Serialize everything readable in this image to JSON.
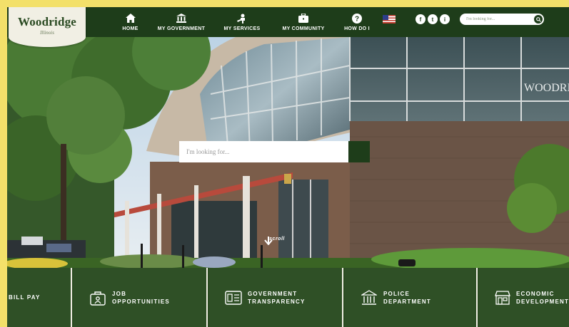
{
  "logo": {
    "name": "Woodridge",
    "sub": "Illinois"
  },
  "nav": [
    {
      "label": "HOME",
      "icon": "home-icon"
    },
    {
      "label": "MY GOVERNMENT",
      "icon": "government-building-icon"
    },
    {
      "label": "MY SERVICES",
      "icon": "services-icon"
    },
    {
      "label": "MY COMMUNITY",
      "icon": "briefcase-icon"
    },
    {
      "label": "HOW DO I",
      "icon": "question-icon"
    }
  ],
  "social": [
    {
      "label": "f",
      "icon": "facebook-icon"
    },
    {
      "label": "t",
      "icon": "twitter-icon"
    },
    {
      "label": "i",
      "icon": "instagram-icon"
    }
  ],
  "header_search": {
    "placeholder": "I'm looking for..."
  },
  "hero": {
    "search_placeholder": "I'm looking for...",
    "building_sign": "WOODRID",
    "scroll_label": "scroll"
  },
  "quick_links": [
    {
      "label": "BILL PAY",
      "icon": "bill-pay-icon"
    },
    {
      "label": "JOB\nOPPORTUNITIES",
      "icon": "job-opportunities-icon"
    },
    {
      "label": "GOVERNMENT\nTRANSPARENCY",
      "icon": "transparency-icon"
    },
    {
      "label": "POLICE\nDEPARTMENT",
      "icon": "police-building-icon"
    },
    {
      "label": "ECONOMIC\nDEVELOPMENT",
      "icon": "shop-icon"
    }
  ],
  "colors": {
    "brand_green": "#1e3d1a",
    "tile_green": "#2f5026",
    "logo_bg": "#f1efe4",
    "outer_frame": "#f3e06a"
  }
}
